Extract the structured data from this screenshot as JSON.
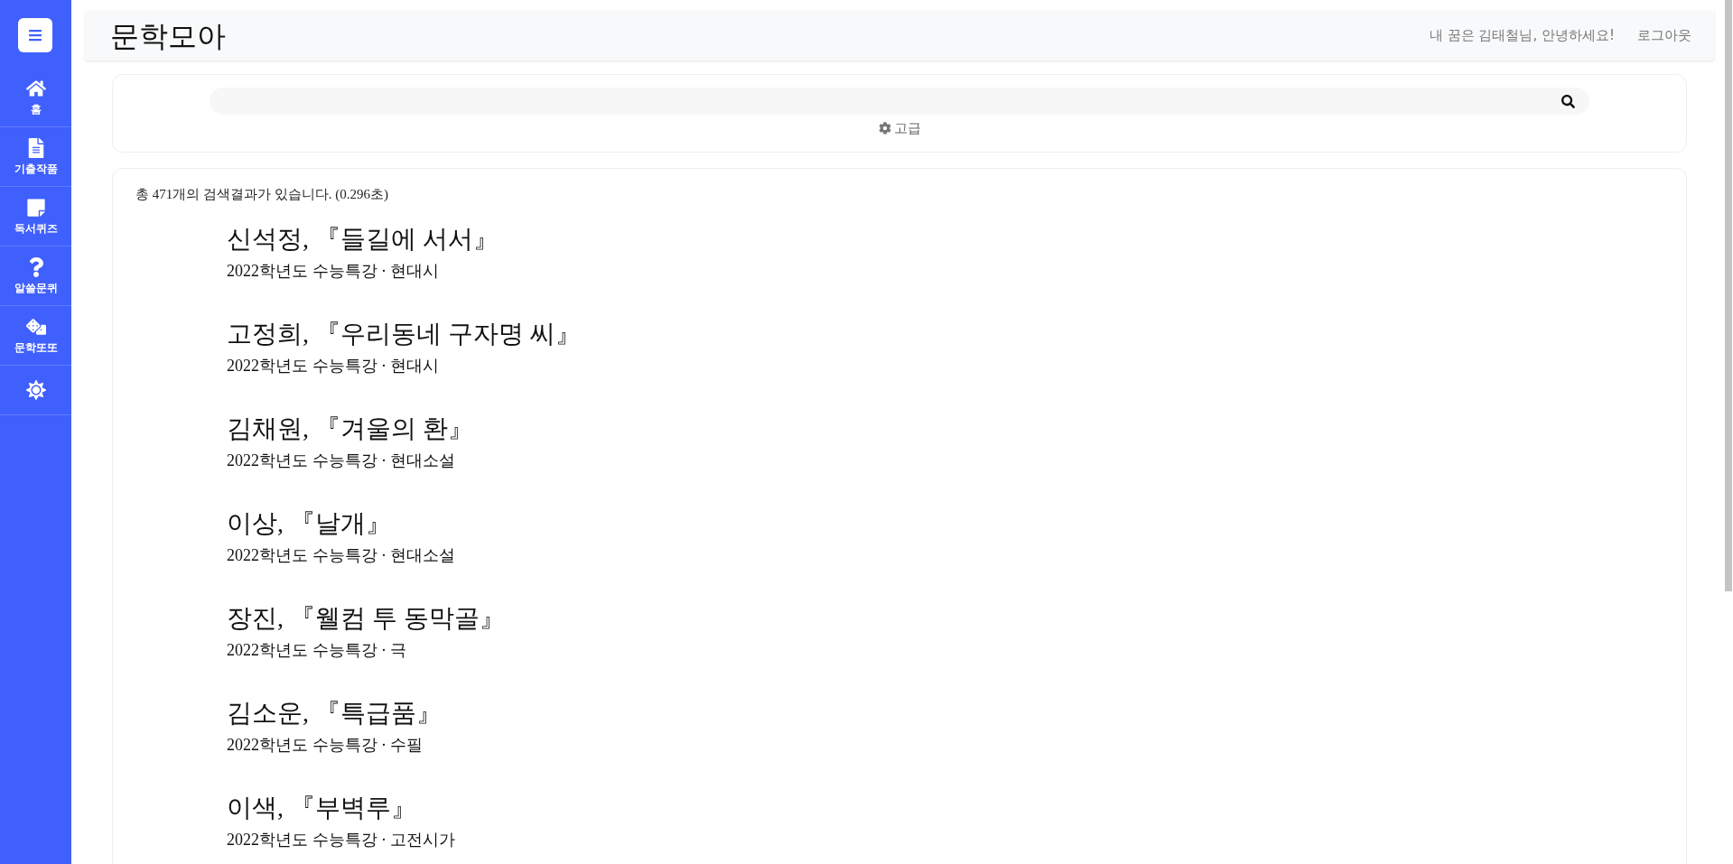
{
  "sidebar": {
    "items": [
      {
        "kind": "labeled",
        "label": "홈"
      },
      {
        "kind": "labeled",
        "label": "기출작품"
      },
      {
        "kind": "labeled",
        "label": "독서퀴즈"
      },
      {
        "kind": "labeled",
        "label": "알쓸문퀴"
      },
      {
        "kind": "labeled",
        "label": "문학또또"
      },
      {
        "kind": "icon"
      }
    ]
  },
  "header": {
    "title": "문학모아",
    "greeting": "내 꿈은 김태철님, 안녕하세요!",
    "logout": "로그아웃"
  },
  "search": {
    "advanced": "고급"
  },
  "results": {
    "summary": "총 471개의 검색결과가 있습니다. (0.296초)",
    "items": [
      {
        "heading": "신석정, 『들길에 서서』",
        "meta": "2022학년도 수능특강 · 현대시"
      },
      {
        "heading": "고정희, 『우리동네 구자명 씨』",
        "meta": "2022학년도 수능특강 · 현대시"
      },
      {
        "heading": "김채원, 『겨울의 환』",
        "meta": "2022학년도 수능특강 · 현대소설"
      },
      {
        "heading": "이상, 『날개』",
        "meta": "2022학년도 수능특강 · 현대소설"
      },
      {
        "heading": "장진, 『웰컴 투 동막골』",
        "meta": "2022학년도 수능특강 · 극"
      },
      {
        "heading": "김소운, 『특급품』",
        "meta": "2022학년도 수능특강 · 수필"
      },
      {
        "heading": "이색, 『부벽루』",
        "meta": "2022학년도 수능특강 · 고전시가"
      }
    ]
  }
}
